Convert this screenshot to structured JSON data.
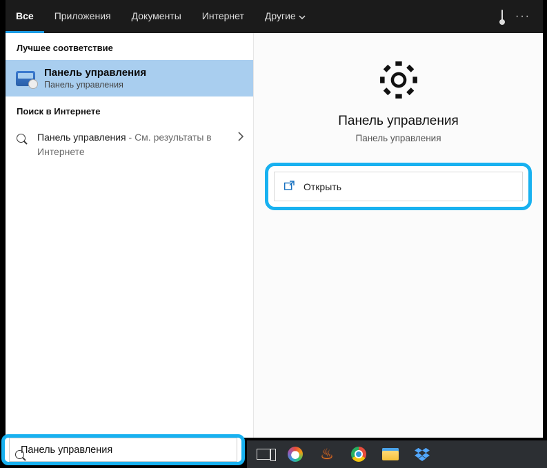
{
  "header": {
    "tabs": [
      {
        "label": "Все",
        "active": true
      },
      {
        "label": "Приложения"
      },
      {
        "label": "Документы"
      },
      {
        "label": "Интернет"
      },
      {
        "label": "Другие",
        "hasDropdown": true
      }
    ]
  },
  "left": {
    "best_match_header": "Лучшее соответствие",
    "best_match": {
      "title": "Панель управления",
      "subtitle": "Панель управления"
    },
    "web_header": "Поиск в Интернете",
    "web_result": {
      "prefix": "Панель управления",
      "suffix": " - См. результаты в Интернете"
    }
  },
  "right": {
    "title": "Панель управления",
    "subtitle": "Панель управления",
    "open_label": "Открыть"
  },
  "search": {
    "value": "Панель управления"
  }
}
